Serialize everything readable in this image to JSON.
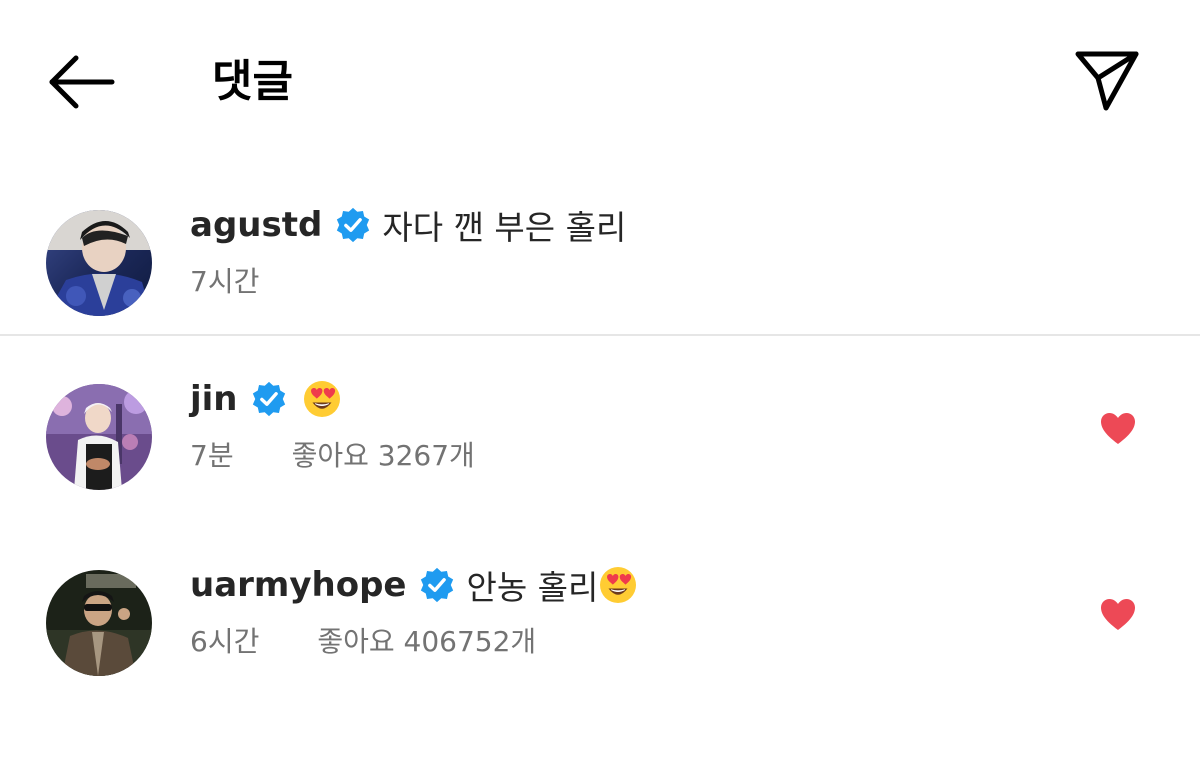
{
  "header": {
    "title": "댓글",
    "back_icon": "arrow-left-icon",
    "share_icon": "paper-plane-icon"
  },
  "comments": [
    {
      "username": "agustd",
      "verified": true,
      "text": "자다 깬 부은 홀리",
      "time": "7시간",
      "likes": "",
      "liked": false
    },
    {
      "username": "jin",
      "verified": true,
      "text": "",
      "emoji": "heart-eyes-emoji",
      "time": "7분",
      "likes": "좋아요 3267개",
      "liked": true
    },
    {
      "username": "uarmyhope",
      "verified": true,
      "text": "안농 홀리",
      "emoji": "heart-eyes-emoji",
      "time": "6시간",
      "likes": "좋아요 406752개",
      "liked": true
    }
  ],
  "colors": {
    "verified_blue": "#1f9bf0",
    "like_red": "#ed4956",
    "secondary_text": "#737373"
  }
}
